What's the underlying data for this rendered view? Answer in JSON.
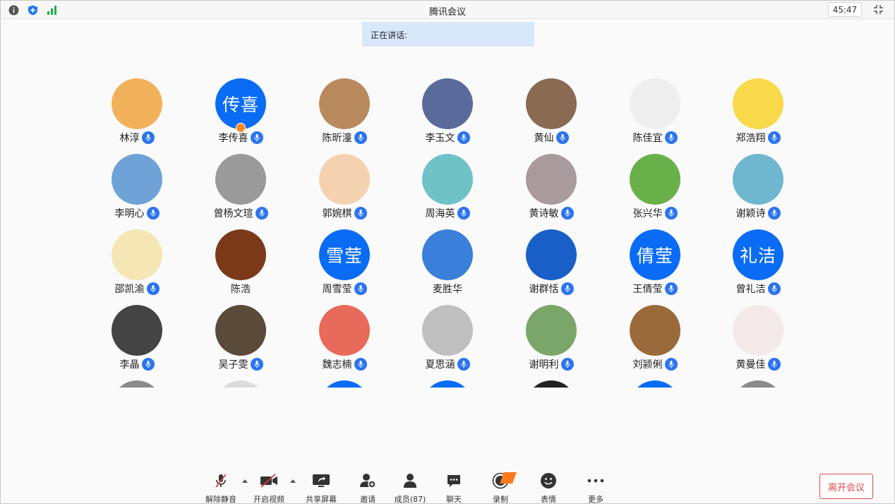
{
  "title": "腾讯会议",
  "timer": "45:47",
  "speaking_label": "正在讲话:",
  "participants": [
    {
      "name": "林淳",
      "avatar_text": "",
      "color": "#f1b15a",
      "mic": true
    },
    {
      "name": "李传喜",
      "avatar_text": "传喜",
      "color": "#0a6cf5",
      "mic": true,
      "host": true
    },
    {
      "name": "陈昕潼",
      "avatar_text": "",
      "color": "#b98a5e",
      "mic": true
    },
    {
      "name": "李玉文",
      "avatar_text": "",
      "color": "#5a6a9a",
      "mic": true
    },
    {
      "name": "黄仙",
      "avatar_text": "",
      "color": "#8a6a52",
      "mic": true
    },
    {
      "name": "陈佳宜",
      "avatar_text": "",
      "color": "#eeeeee",
      "mic": true
    },
    {
      "name": "郑浩翔",
      "avatar_text": "",
      "color": "#f7d94a",
      "mic": true
    },
    {
      "name": "李明心",
      "avatar_text": "",
      "color": "#6fa3d8",
      "mic": true
    },
    {
      "name": "曾杨文瑄",
      "avatar_text": "",
      "color": "#9a9a9a",
      "mic": true
    },
    {
      "name": "郭婉棋",
      "avatar_text": "",
      "color": "#f4d2b0",
      "mic": true
    },
    {
      "name": "周海英",
      "avatar_text": "",
      "color": "#6fc3c7",
      "mic": true
    },
    {
      "name": "黄诗敏",
      "avatar_text": "",
      "color": "#a99a9e",
      "mic": true
    },
    {
      "name": "张兴华",
      "avatar_text": "",
      "color": "#6ab04a",
      "mic": true
    },
    {
      "name": "谢颖诗",
      "avatar_text": "",
      "color": "#6fb6cf",
      "mic": true
    },
    {
      "name": "邵凯渝",
      "avatar_text": "",
      "color": "#f6e6b5",
      "mic": true
    },
    {
      "name": "陈浩",
      "avatar_text": "",
      "color": "#7a3a1a",
      "mic": false
    },
    {
      "name": "周雪莹",
      "avatar_text": "雪莹",
      "color": "#0a6cf5",
      "mic": true
    },
    {
      "name": "麦胜华",
      "avatar_text": "",
      "color": "#3a7fd9",
      "mic": false
    },
    {
      "name": "谢群恬",
      "avatar_text": "",
      "color": "#1a5fc7",
      "mic": true
    },
    {
      "name": "王倩莹",
      "avatar_text": "倩莹",
      "color": "#0a6cf5",
      "mic": true
    },
    {
      "name": "曾礼洁",
      "avatar_text": "礼洁",
      "color": "#0a6cf5",
      "mic": true
    },
    {
      "name": "李晶",
      "avatar_text": "",
      "color": "#444444",
      "mic": true
    },
    {
      "name": "吴子雯",
      "avatar_text": "",
      "color": "#5a4a3a",
      "mic": true
    },
    {
      "name": "魏志楠",
      "avatar_text": "",
      "color": "#e86a5a",
      "mic": true
    },
    {
      "name": "夏思涵",
      "avatar_text": "",
      "color": "#bfbfbf",
      "mic": true
    },
    {
      "name": "谢明利",
      "avatar_text": "",
      "color": "#7aa66a",
      "mic": true
    },
    {
      "name": "刘颍俐",
      "avatar_text": "",
      "color": "#9a6a3a",
      "mic": true
    },
    {
      "name": "黄曼佳",
      "avatar_text": "",
      "color": "#f3e9e9",
      "mic": true
    },
    {
      "name": "",
      "avatar_text": "",
      "color": "#8a8a8a",
      "mic": false
    },
    {
      "name": "",
      "avatar_text": "",
      "color": "#dcdcdc",
      "mic": false
    },
    {
      "name": "",
      "avatar_text": "",
      "color": "#0a6cf5",
      "mic": false
    },
    {
      "name": "",
      "avatar_text": "",
      "color": "#0a6cf5",
      "mic": false
    },
    {
      "name": "",
      "avatar_text": "",
      "color": "#222222",
      "mic": false
    },
    {
      "name": "",
      "avatar_text": "",
      "color": "#0a6cf5",
      "mic": false
    },
    {
      "name": "",
      "avatar_text": "",
      "color": "#8a8a8a",
      "mic": false
    }
  ],
  "toolbar": {
    "unmute": "解除静音",
    "start_video": "开启视频",
    "share_screen": "共享屏幕",
    "invite": "邀请",
    "members": "成员(87)",
    "chat": "聊天",
    "record": "录制",
    "reactions": "表情",
    "more": "更多"
  },
  "leave_label": "离开会议",
  "accent_color": "#0a6cf5",
  "leave_color": "#e04a4a"
}
